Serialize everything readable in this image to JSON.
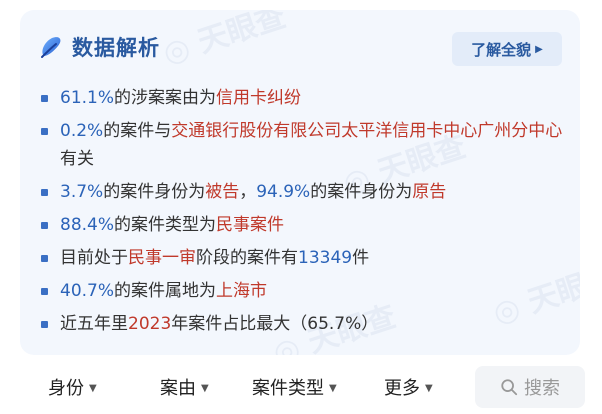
{
  "card": {
    "title": "数据解析",
    "learn_more_label": "了解全貌"
  },
  "items": [
    {
      "segments": [
        {
          "text": "61.1%",
          "style": "blue"
        },
        {
          "text": "的涉案案由为",
          "style": ""
        },
        {
          "text": "信用卡纠纷",
          "style": "red"
        }
      ]
    },
    {
      "segments": [
        {
          "text": "0.2%",
          "style": "blue"
        },
        {
          "text": "的案件与",
          "style": ""
        },
        {
          "text": "交通银行股份有限公司太平洋信用卡中心广州分中心",
          "style": "red"
        },
        {
          "text": "有关",
          "style": ""
        }
      ]
    },
    {
      "segments": [
        {
          "text": "3.7%",
          "style": "blue"
        },
        {
          "text": "的案件身份为",
          "style": ""
        },
        {
          "text": "被告",
          "style": "red"
        },
        {
          "text": "，",
          "style": ""
        },
        {
          "text": "94.9%",
          "style": "blue"
        },
        {
          "text": "的案件身份为",
          "style": ""
        },
        {
          "text": "原告",
          "style": "red"
        }
      ]
    },
    {
      "segments": [
        {
          "text": "88.4%",
          "style": "blue"
        },
        {
          "text": "的案件类型为",
          "style": ""
        },
        {
          "text": "民事案件",
          "style": "red"
        }
      ]
    },
    {
      "segments": [
        {
          "text": "目前处于",
          "style": ""
        },
        {
          "text": "民事一审",
          "style": "red"
        },
        {
          "text": "阶段的案件有",
          "style": ""
        },
        {
          "text": "13349",
          "style": "blue"
        },
        {
          "text": "件",
          "style": ""
        }
      ]
    },
    {
      "segments": [
        {
          "text": "40.7%",
          "style": "blue"
        },
        {
          "text": "的案件属地为",
          "style": ""
        },
        {
          "text": "上海市",
          "style": "red"
        }
      ]
    },
    {
      "segments": [
        {
          "text": "近五年里",
          "style": ""
        },
        {
          "text": "2023",
          "style": "red"
        },
        {
          "text": "年案件占比最大（65.7%）",
          "style": ""
        }
      ]
    }
  ],
  "filters": {
    "identity": "身份",
    "cause": "案由",
    "case_type": "案件类型",
    "more": "更多",
    "search_label": "搜索"
  },
  "colors": {
    "accent_blue": "#2b63b8",
    "highlight_red": "#c0392b",
    "card_bg": "#f3f7fd"
  }
}
